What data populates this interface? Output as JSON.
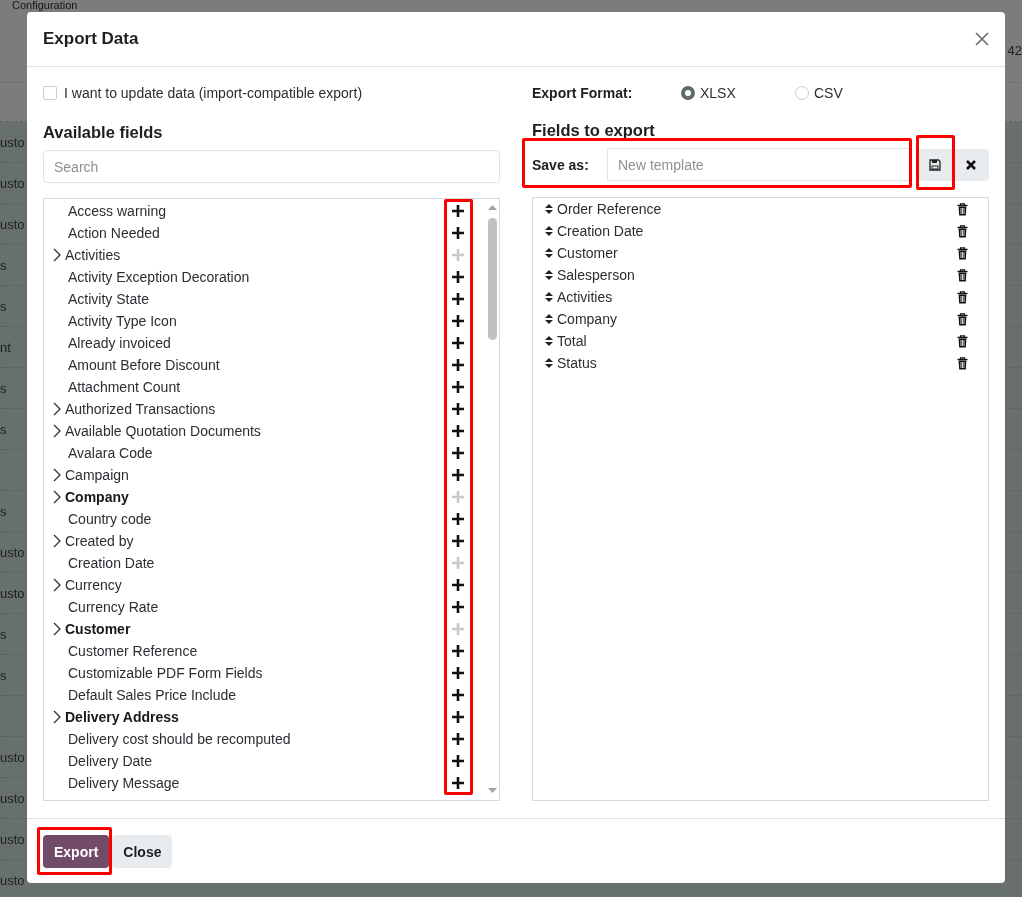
{
  "background_page": {
    "breadcrumb": "Configuration",
    "edge_text": "42",
    "side_rows": [
      "usto",
      "usto",
      "usto",
      "s",
      "s",
      "nt",
      "s",
      "s",
      null,
      "s",
      "usto",
      "usto",
      "s",
      "s",
      null,
      "usto",
      "usto",
      "usto",
      "usto"
    ]
  },
  "dialog": {
    "title": "Export Data",
    "import_compatible": {
      "label": "I want to update data (import-compatible export)",
      "checked": false
    },
    "export_format": {
      "label": "Export Format:",
      "options": [
        {
          "label": "XLSX",
          "selected": true
        },
        {
          "label": "CSV",
          "selected": false
        }
      ]
    },
    "available_fields": {
      "title": "Available fields",
      "search": {
        "placeholder": "Search"
      },
      "add_buttons_highlighted": true,
      "items": [
        {
          "label": "Access warning",
          "expandable": false,
          "required": false,
          "added": false
        },
        {
          "label": "Action Needed",
          "expandable": false,
          "required": false,
          "added": false
        },
        {
          "label": "Activities",
          "expandable": true,
          "required": false,
          "added": true
        },
        {
          "label": "Activity Exception Decoration",
          "expandable": false,
          "required": false,
          "added": false
        },
        {
          "label": "Activity State",
          "expandable": false,
          "required": false,
          "added": false
        },
        {
          "label": "Activity Type Icon",
          "expandable": false,
          "required": false,
          "added": false
        },
        {
          "label": "Already invoiced",
          "expandable": false,
          "required": false,
          "added": false
        },
        {
          "label": "Amount Before Discount",
          "expandable": false,
          "required": false,
          "added": false
        },
        {
          "label": "Attachment Count",
          "expandable": false,
          "required": false,
          "added": false
        },
        {
          "label": "Authorized Transactions",
          "expandable": true,
          "required": false,
          "added": false
        },
        {
          "label": "Available Quotation Documents",
          "expandable": true,
          "required": false,
          "added": false
        },
        {
          "label": "Avalara Code",
          "expandable": false,
          "required": false,
          "added": false
        },
        {
          "label": "Campaign",
          "expandable": true,
          "required": false,
          "added": false
        },
        {
          "label": "Company",
          "expandable": true,
          "required": true,
          "added": true
        },
        {
          "label": "Country code",
          "expandable": false,
          "required": false,
          "added": false
        },
        {
          "label": "Created by",
          "expandable": true,
          "required": false,
          "added": false
        },
        {
          "label": "Creation Date",
          "expandable": false,
          "required": false,
          "added": true
        },
        {
          "label": "Currency",
          "expandable": true,
          "required": false,
          "added": false
        },
        {
          "label": "Currency Rate",
          "expandable": false,
          "required": false,
          "added": false
        },
        {
          "label": "Customer",
          "expandable": true,
          "required": true,
          "added": true
        },
        {
          "label": "Customer Reference",
          "expandable": false,
          "required": false,
          "added": false
        },
        {
          "label": "Customizable PDF Form Fields",
          "expandable": false,
          "required": false,
          "added": false
        },
        {
          "label": "Default Sales Price Include",
          "expandable": false,
          "required": false,
          "added": false
        },
        {
          "label": "Delivery Address",
          "expandable": true,
          "required": true,
          "added": false
        },
        {
          "label": "Delivery cost should be recomputed",
          "expandable": false,
          "required": false,
          "added": false
        },
        {
          "label": "Delivery Date",
          "expandable": false,
          "required": false,
          "added": false
        },
        {
          "label": "Delivery Message",
          "expandable": false,
          "required": false,
          "added": false
        }
      ]
    },
    "fields_to_export": {
      "title": "Fields to export",
      "save_as": {
        "label": "Save as:",
        "placeholder": "New template",
        "highlighted": true
      },
      "save_button": {
        "highlighted": true
      },
      "items": [
        "Order Reference",
        "Creation Date",
        "Customer",
        "Salesperson",
        "Activities",
        "Company",
        "Total",
        "Status"
      ]
    },
    "footer": {
      "buttons": [
        {
          "label": "Export",
          "kind": "primary",
          "highlighted": true
        },
        {
          "label": "Close",
          "kind": "secondary",
          "highlighted": false
        }
      ]
    }
  }
}
